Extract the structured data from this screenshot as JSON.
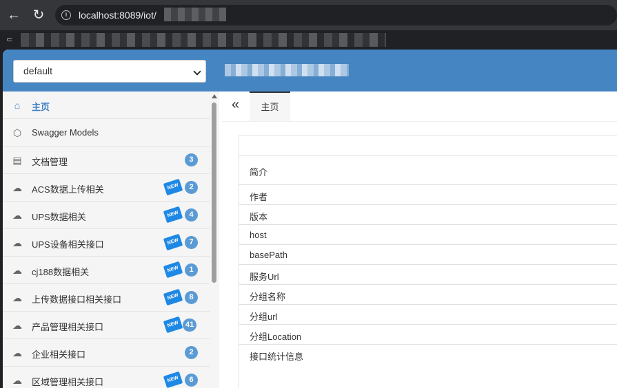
{
  "browser": {
    "url": "localhost:8089/iot/"
  },
  "header": {
    "group_selected": "default"
  },
  "sidebar": {
    "items": [
      {
        "label": "主页",
        "icon": "home-icon",
        "count": null,
        "is_new": false,
        "active": true
      },
      {
        "label": "Swagger Models",
        "icon": "cube-icon",
        "count": null,
        "is_new": false,
        "active": false
      },
      {
        "label": "文档管理",
        "icon": "document-settings-icon",
        "count": "3",
        "is_new": false,
        "active": false
      },
      {
        "label": "ACS数据上传相关",
        "icon": "cloud-icon",
        "count": "2",
        "is_new": true,
        "active": false
      },
      {
        "label": "UPS数据相关",
        "icon": "cloud-icon",
        "count": "4",
        "is_new": true,
        "active": false
      },
      {
        "label": "UPS设备相关接口",
        "icon": "cloud-icon",
        "count": "7",
        "is_new": true,
        "active": false
      },
      {
        "label": "cj188数据相关",
        "icon": "cloud-icon",
        "count": "1",
        "is_new": true,
        "active": false
      },
      {
        "label": "上传数据接口相关接口",
        "icon": "cloud-icon",
        "count": "8",
        "is_new": true,
        "active": false
      },
      {
        "label": "产品管理相关接口",
        "icon": "cloud-icon",
        "count": "41",
        "is_new": true,
        "active": false
      },
      {
        "label": "企业相关接口",
        "icon": "cloud-icon",
        "count": "2",
        "is_new": false,
        "active": false
      },
      {
        "label": "区域管理相关接口",
        "icon": "cloud-icon",
        "count": "6",
        "is_new": true,
        "active": false
      }
    ],
    "new_tag_label": "NEW"
  },
  "main": {
    "tabs": [
      {
        "label": "主页"
      }
    ],
    "info_rows": [
      "简介",
      "作者",
      "版本",
      "host",
      "basePath",
      "服务Url",
      "分组名称",
      "分组url",
      "分组Location",
      "接口统计信息"
    ]
  }
}
